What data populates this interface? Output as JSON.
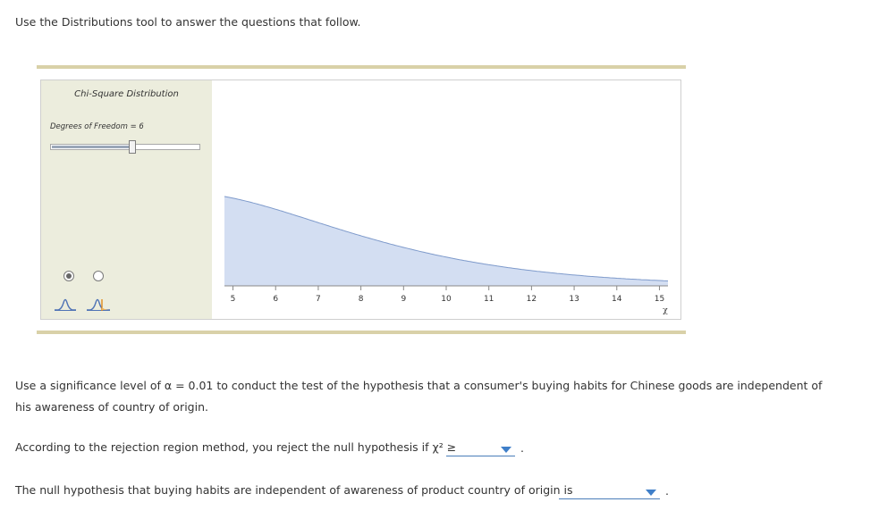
{
  "intro": "Use the Distributions tool to answer the questions that follow.",
  "tool": {
    "panel_title": "Chi-Square Distribution",
    "dof_label": "Degrees of Freedom = 6",
    "dof_value": 6,
    "slider_fraction": 0.55,
    "radio_options": [
      {
        "checked": true,
        "icon": "normal-curve-icon"
      },
      {
        "checked": false,
        "icon": "shaded-tail-curve-icon"
      }
    ],
    "accent_fill": "#d3def2",
    "accent_stroke": "#7e9acb"
  },
  "chart_data": {
    "type": "area",
    "distribution": "chi-square",
    "df": 6,
    "xlim": [
      4.8,
      15.2
    ],
    "x_ticks": [
      "5",
      "6",
      "7",
      "8",
      "9",
      "10",
      "11",
      "12",
      "13",
      "14",
      "15"
    ],
    "xlabel": "χ",
    "shade_from": 4.8
  },
  "question": {
    "text": "Use a significance level of α = 0.01 to conduct the test of the hypothesis that a consumer's buying habits for Chinese goods are independent of his awareness of country of origin."
  },
  "rejection": {
    "text": "According to the rejection region method, you reject the null hypothesis if χ² ≥",
    "selected": "",
    "end": "."
  },
  "conclusion": {
    "text": "The null hypothesis that buying habits are independent of awareness of product country of origin is",
    "selected": "",
    "end": "."
  }
}
